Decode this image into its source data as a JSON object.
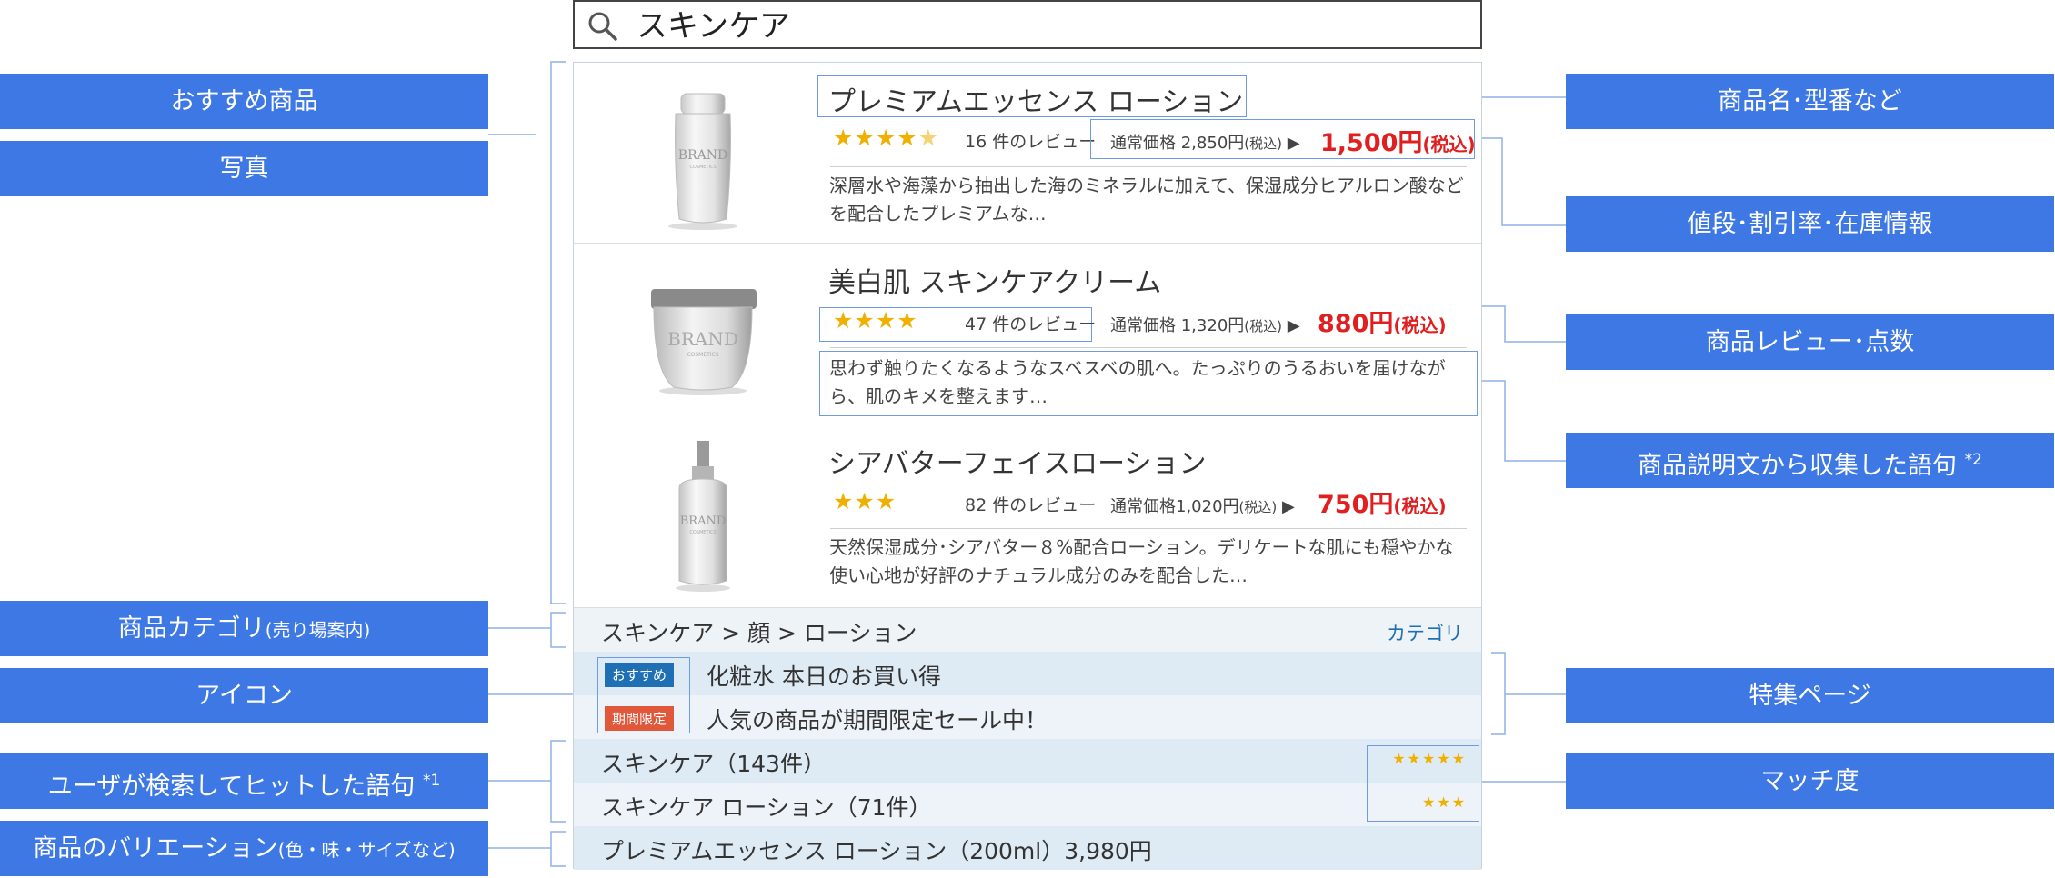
{
  "search": {
    "query": "スキンケア"
  },
  "products": [
    {
      "name": "プレミアムエッセンス ローション",
      "rating_stars": 4.5,
      "stars_text": "★★★★",
      "review_count_text": "16 件のレビュー",
      "regular_label": "通常価格",
      "regular_price": "2,850円",
      "tax_small": "(税込)",
      "arrow": "▶",
      "sale_price": "1,500円",
      "sale_tax": "(税込)",
      "description": "深層水や海藻から抽出した海のミネラルに加えて、保湿成分ヒアルロン酸などを配合したプレミアムな…",
      "brand": "BRAND",
      "brand_sub": "COSMETICS"
    },
    {
      "name": "美白肌 スキンケアクリーム",
      "rating_stars": 4,
      "stars_text": "★★★★",
      "review_count_text": "47 件のレビュー",
      "regular_label": "通常価格",
      "regular_price": "1,320円",
      "tax_small": "(税込)",
      "arrow": "▶",
      "sale_price": "880円",
      "sale_tax": "(税込)",
      "description": "思わず触りたくなるようなスベスベの肌へ。たっぷりのうるおいを届けながら、肌のキメを整えます…",
      "brand": "BRAND",
      "brand_sub": "COSMETICS"
    },
    {
      "name": "シアバターフェイスローション",
      "rating_stars": 3,
      "stars_text": "★★★",
      "review_count_text": "82 件のレビュー",
      "regular_label": "通常価格",
      "regular_price": "1,020円",
      "tax_small": "(税込)",
      "arrow": "▶",
      "sale_price": "750円",
      "sale_tax": "(税込)",
      "description": "天然保湿成分･シアバター８%配合ローション。デリケートな肌にも穏やかな使い心地が好評のナチュラル成分のみを配合した…",
      "brand": "BRAND",
      "brand_sub": "COSMETICS"
    }
  ],
  "category": {
    "path": "スキンケア > 顔 > ローション",
    "link": "カテゴリ"
  },
  "features": [
    {
      "badge": "おすすめ",
      "badge_color": "#1f6fb5",
      "text": "化粧水 本日のお買い得"
    },
    {
      "badge": "期間限定",
      "badge_color": "#e0573a",
      "text": "人気の商品が期間限定セール中！"
    }
  ],
  "search_terms": [
    {
      "text": "スキンケア（143件）",
      "stars": "★★★★★",
      "match": 5
    },
    {
      "text": "スキンケア ローション（71件）",
      "stars": "★★★",
      "match": 3
    }
  ],
  "variation": {
    "text": "プレミアムエッセンス ローション（200ml）3,980円"
  },
  "labels_left": {
    "recommended": "おすすめ商品",
    "photo": "写真",
    "category_main": "商品カテゴリ",
    "category_sub": "(売り場案内)",
    "icon": "アイコン",
    "user_terms_main": "ユーザが検索してヒットした語句",
    "user_terms_note": "*1",
    "variation_main": "商品のバリエーション",
    "variation_sub": "(色・味・サイズなど)"
  },
  "labels_right": {
    "product_name": "商品名･型番など",
    "price": "値段･割引率･在庫情報",
    "review": "商品レビュー･点数",
    "desc_terms_main": "商品説明文から収集した語句",
    "desc_terms_note": "*2",
    "feature_page": "特集ページ",
    "match": "マッチ度"
  },
  "colors": {
    "label_bg": "#3d78e4",
    "highlight_border": "#6f9be6",
    "sale_red": "#e02020",
    "star_yellow": "#f0b000",
    "link_blue": "#1f6fb5"
  }
}
